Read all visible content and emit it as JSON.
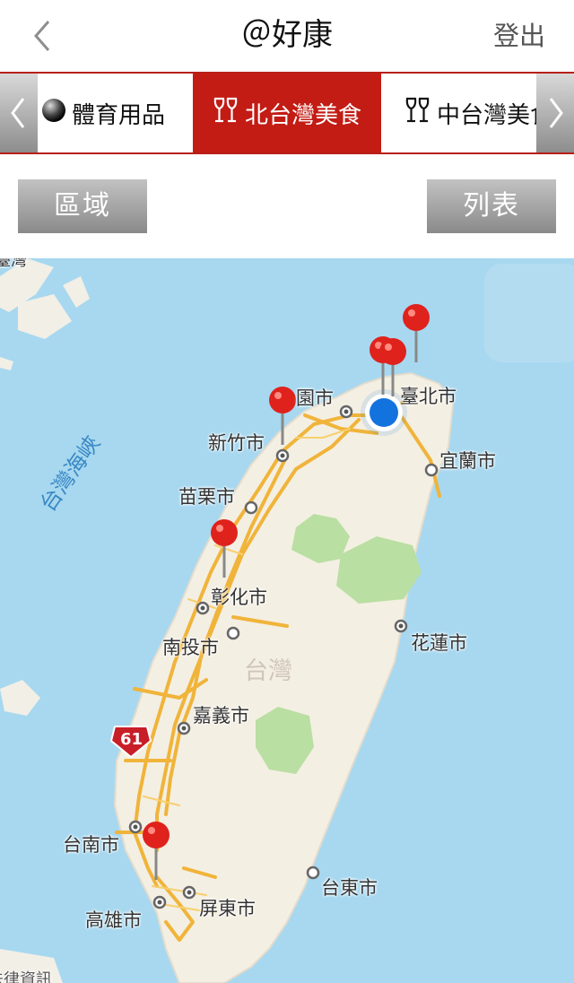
{
  "header": {
    "back_icon": "chevron-left-icon",
    "title": "＠好康",
    "logout_label": "登出"
  },
  "category_tabs": {
    "left_arrow_icon": "chevron-left-icon",
    "right_arrow_icon": "chevron-right-icon",
    "items": [
      {
        "label": "體育用品",
        "icon": "ball-icon",
        "selected": false
      },
      {
        "label": "北台灣美食",
        "icon": "wine-glasses-icon",
        "selected": true
      },
      {
        "label": "中台灣美食",
        "icon": "wine-glasses-icon",
        "selected": false
      }
    ]
  },
  "buttons": {
    "region_label": "區域",
    "list_label": "列表"
  },
  "map": {
    "sea_label": "台灣海峽",
    "island_label": "台灣",
    "highway_shield": "61",
    "top_fragment": "臺灣",
    "bottom_fragment": "法律資訊",
    "cities": [
      {
        "name": "臺北市"
      },
      {
        "name": "桃園市",
        "shown": "園市"
      },
      {
        "name": "新竹市"
      },
      {
        "name": "宜蘭市"
      },
      {
        "name": "苗栗市"
      },
      {
        "name": "彰化市"
      },
      {
        "name": "南投市"
      },
      {
        "name": "花蓮市"
      },
      {
        "name": "嘉義市"
      },
      {
        "name": "台南市"
      },
      {
        "name": "台東市"
      },
      {
        "name": "高雄市"
      },
      {
        "name": "屏東市"
      }
    ],
    "pin_color": "#e0221c",
    "user_location_color": "#1273de",
    "pin_count": 6
  }
}
